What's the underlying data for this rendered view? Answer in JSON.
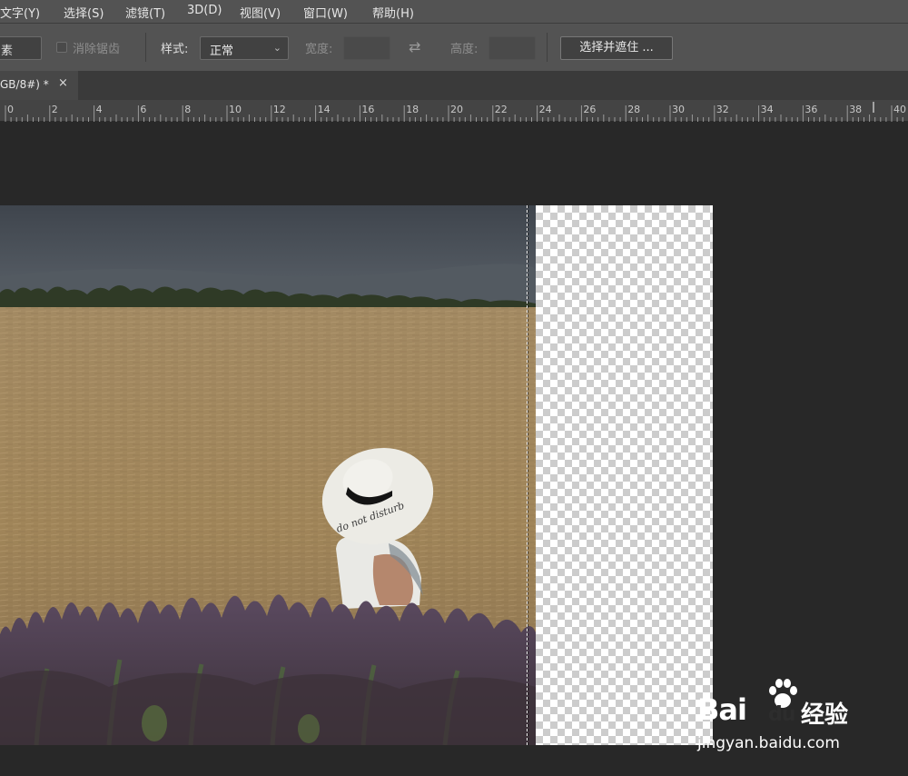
{
  "menu": [
    "文字(Y)",
    "选择(S)",
    "滤镜(T)",
    "3D(D)",
    "视图(V)",
    "窗口(W)",
    "帮助(H)"
  ],
  "options": {
    "feather_unit": "素",
    "antialias_label": "消除锯齿",
    "style_label": "样式:",
    "style_value": "正常",
    "width_label": "宽度:",
    "height_label": "高度:",
    "select_mask_button": "选择并遮住 ..."
  },
  "tab": {
    "title": "GB/8#) *",
    "close": "×"
  },
  "ruler": {
    "labels": [
      "0",
      "2",
      "4",
      "6",
      "8",
      "10",
      "12",
      "14",
      "16",
      "18",
      "20",
      "22",
      "24",
      "26",
      "28",
      "30",
      "32",
      "34",
      "36",
      "38",
      "40"
    ]
  },
  "watermark": {
    "brand": "Bai",
    "brand2": "du",
    "cn": "经验",
    "url": "jingyan.baidu.com"
  },
  "colors": {
    "menubar": "#535353",
    "canvas_bg": "#282828",
    "ruler": "#444444"
  },
  "icons": [
    "swap-icon",
    "chevron-down-icon",
    "close-icon",
    "paw-icon"
  ]
}
